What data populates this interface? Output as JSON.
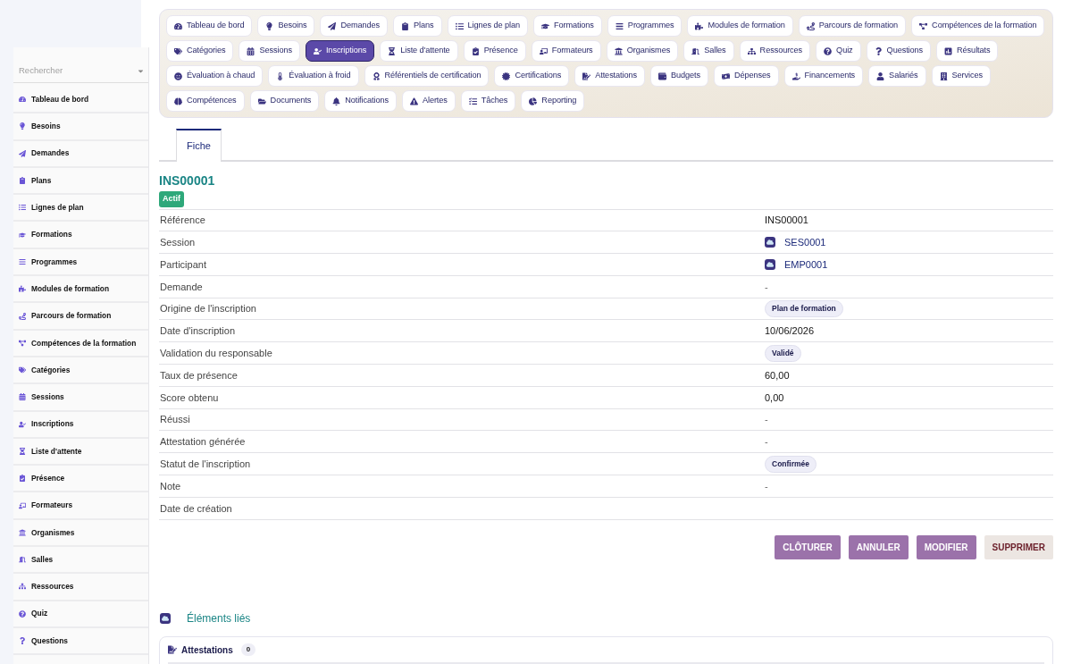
{
  "sidebar": {
    "search": {
      "placeholder": "Rechercher"
    },
    "items": [
      "Tableau de bord",
      "Besoins",
      "Demandes",
      "Plans",
      "Lignes de plan",
      "Formations",
      "Programmes",
      "Modules de formation",
      "Parcours de formation",
      "Compétences de la formation",
      "Catégories",
      "Sessions",
      "Inscriptions",
      "Liste d'attente",
      "Présence",
      "Formateurs",
      "Organismes",
      "Salles",
      "Ressources",
      "Quiz",
      "Questions"
    ]
  },
  "nav": [
    {
      "label": "Tableau de bord",
      "selected": false
    },
    {
      "label": "Besoins",
      "selected": false
    },
    {
      "label": "Demandes",
      "selected": false
    },
    {
      "label": "Plans",
      "selected": false
    },
    {
      "label": "Lignes de plan",
      "selected": false
    },
    {
      "label": "Formations",
      "selected": false
    },
    {
      "label": "Programmes",
      "selected": false
    },
    {
      "label": "Modules de formation",
      "selected": false
    },
    {
      "label": "Parcours de formation",
      "selected": false
    },
    {
      "label": "Compétences de la formation",
      "selected": false
    },
    {
      "label": "Catégories",
      "selected": false
    },
    {
      "label": "Sessions",
      "selected": false
    },
    {
      "label": "Inscriptions",
      "selected": true
    },
    {
      "label": "Liste d'attente",
      "selected": false
    },
    {
      "label": "Présence",
      "selected": false
    },
    {
      "label": "Formateurs",
      "selected": false
    },
    {
      "label": "Organismes",
      "selected": false
    },
    {
      "label": "Salles",
      "selected": false
    },
    {
      "label": "Ressources",
      "selected": false
    },
    {
      "label": "Quiz",
      "selected": false
    },
    {
      "label": "Questions",
      "selected": false
    },
    {
      "label": "Résultats",
      "selected": false
    },
    {
      "label": "Évaluation à chaud",
      "selected": false
    },
    {
      "label": "Évaluation à froid",
      "selected": false
    },
    {
      "label": "Référentiels de certification",
      "selected": false
    },
    {
      "label": "Certifications",
      "selected": false
    },
    {
      "label": "Attestations",
      "selected": false
    },
    {
      "label": "Budgets",
      "selected": false
    },
    {
      "label": "Dépenses",
      "selected": false
    },
    {
      "label": "Financements",
      "selected": false
    },
    {
      "label": "Salariés",
      "selected": false
    },
    {
      "label": "Services",
      "selected": false
    },
    {
      "label": "Compétences",
      "selected": false
    },
    {
      "label": "Documents",
      "selected": false
    },
    {
      "label": "Notifications",
      "selected": false
    },
    {
      "label": "Alertes",
      "selected": false
    },
    {
      "label": "Tâches",
      "selected": false
    },
    {
      "label": "Reporting",
      "selected": false
    }
  ],
  "tabs": [
    {
      "label": "Fiche",
      "selected": true
    }
  ],
  "record": {
    "title": "INS00001",
    "status": "Actif",
    "fields": [
      {
        "label": "Référence",
        "kind": "text",
        "value": "INS00001"
      },
      {
        "label": "Session",
        "kind": "link",
        "value": "SES0001"
      },
      {
        "label": "Participant",
        "kind": "link",
        "value": "EMP0001"
      },
      {
        "label": "Demande",
        "kind": "dash",
        "value": "-"
      },
      {
        "label": "Origine de l'inscription",
        "kind": "badge",
        "value": "Plan de formation"
      },
      {
        "label": "Date d'inscription",
        "kind": "text",
        "value": "10/06/2026"
      },
      {
        "label": "Validation du responsable",
        "kind": "badge",
        "value": "Validé"
      },
      {
        "label": "Taux de présence",
        "kind": "text",
        "value": "60,00"
      },
      {
        "label": "Score obtenu",
        "kind": "text",
        "value": "0,00"
      },
      {
        "label": "Réussi",
        "kind": "dash",
        "value": "-"
      },
      {
        "label": "Attestation générée",
        "kind": "dash",
        "value": "-"
      },
      {
        "label": "Statut de l'inscription",
        "kind": "badge",
        "value": "Confirmée"
      },
      {
        "label": "Note",
        "kind": "dash",
        "value": "-"
      },
      {
        "label": "Date de création",
        "kind": "empty"
      }
    ]
  },
  "actions": [
    {
      "label": "CLÔTURER",
      "kind": "primary"
    },
    {
      "label": "ANNULER",
      "kind": "primary"
    },
    {
      "label": "MODIFIER",
      "kind": "primary"
    },
    {
      "label": "SUPPRIMER",
      "kind": "danger"
    }
  ],
  "related": {
    "title": "Éléments liés",
    "sections": [
      {
        "title": "Attestations",
        "count": "0"
      }
    ]
  }
}
